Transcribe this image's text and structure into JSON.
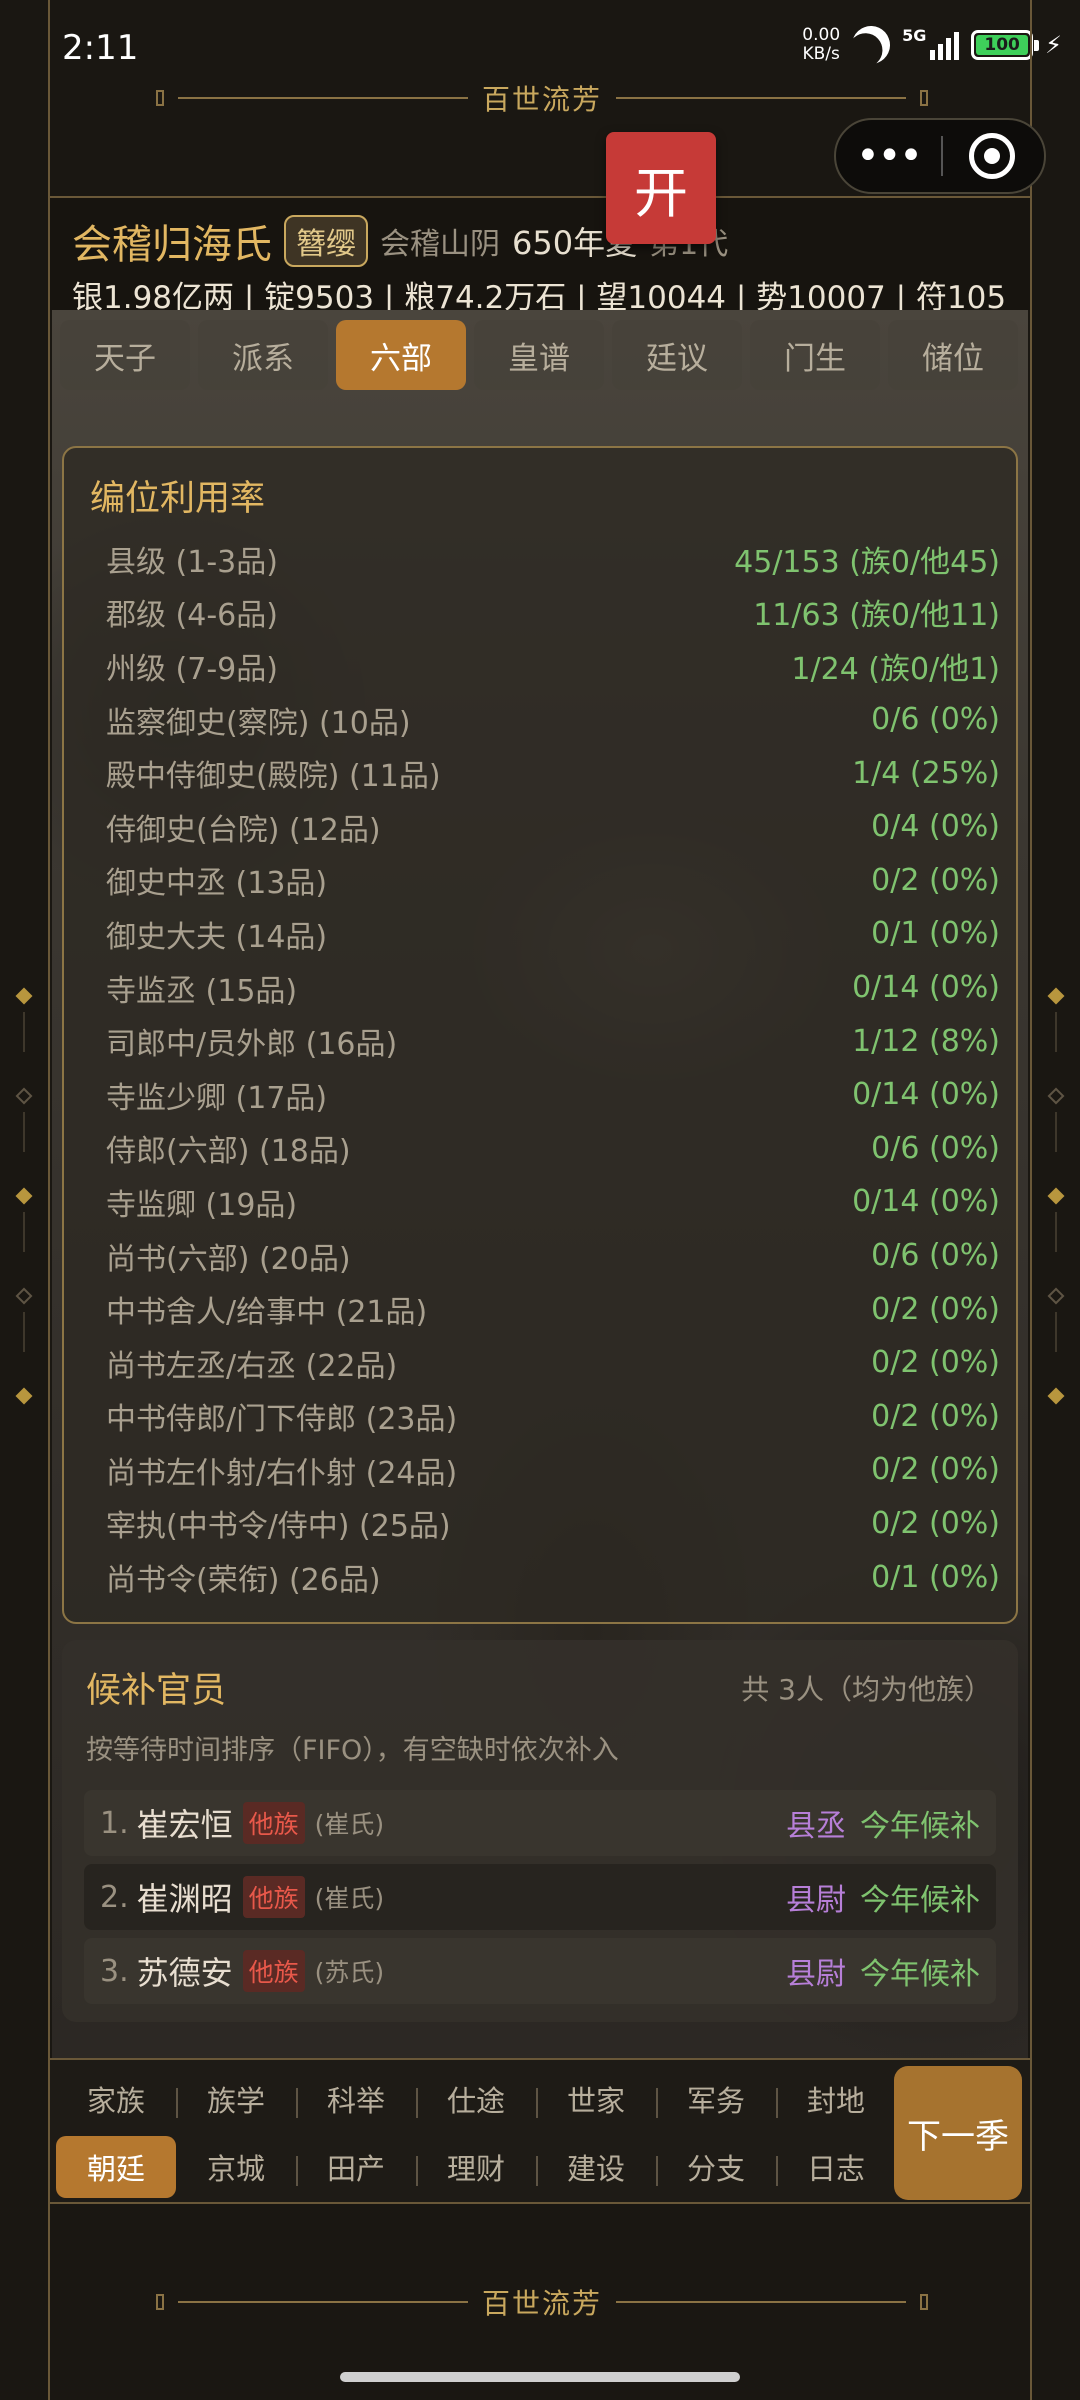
{
  "status_bar": {
    "time": "2:11",
    "net_speed_value": "0.00",
    "net_speed_unit": "KB/s",
    "network": "5G",
    "battery": "100"
  },
  "banner": {
    "title": "百世流芳"
  },
  "open_button": {
    "label": "开"
  },
  "capsule": {
    "more_icon": "more-dots-icon",
    "close_icon": "target-icon"
  },
  "header": {
    "clan_name": "会稽归海氏",
    "rank_badge": "簪缨",
    "place": "会稽山阴",
    "year": "650年夏",
    "generation": "第1代",
    "resources": "银1.98亿两 | 锭9503 | 粮74.2万石 | 望10044 | 势10007 | 符105"
  },
  "tabs": [
    {
      "label": "天子"
    },
    {
      "label": "派系"
    },
    {
      "label": "六部"
    },
    {
      "label": "皇谱"
    },
    {
      "label": "廷议"
    },
    {
      "label": "门生"
    },
    {
      "label": "储位"
    }
  ],
  "active_tab": "六部",
  "utilization": {
    "title": "编位利用率",
    "rows": [
      {
        "label": "县级 (1-3品)",
        "value": "45/153 (族0/他45)"
      },
      {
        "label": "郡级 (4-6品)",
        "value": "11/63 (族0/他11)"
      },
      {
        "label": "州级 (7-9品)",
        "value": "1/24 (族0/他1)"
      },
      {
        "label": "监察御史(察院) (10品)",
        "value": "0/6 (0%)"
      },
      {
        "label": "殿中侍御史(殿院) (11品)",
        "value": "1/4 (25%)"
      },
      {
        "label": "侍御史(台院) (12品)",
        "value": "0/4 (0%)"
      },
      {
        "label": "御史中丞 (13品)",
        "value": "0/2 (0%)"
      },
      {
        "label": "御史大夫 (14品)",
        "value": "0/1 (0%)"
      },
      {
        "label": "寺监丞 (15品)",
        "value": "0/14 (0%)"
      },
      {
        "label": "司郎中/员外郎 (16品)",
        "value": "1/12 (8%)"
      },
      {
        "label": "寺监少卿 (17品)",
        "value": "0/14 (0%)"
      },
      {
        "label": "侍郎(六部) (18品)",
        "value": "0/6 (0%)"
      },
      {
        "label": "寺监卿 (19品)",
        "value": "0/14 (0%)"
      },
      {
        "label": "尚书(六部) (20品)",
        "value": "0/6 (0%)"
      },
      {
        "label": "中书舍人/给事中 (21品)",
        "value": "0/2 (0%)"
      },
      {
        "label": "尚书左丞/右丞 (22品)",
        "value": "0/2 (0%)"
      },
      {
        "label": "中书侍郎/门下侍郎 (23品)",
        "value": "0/2 (0%)"
      },
      {
        "label": "尚书左仆射/右仆射 (24品)",
        "value": "0/2 (0%)"
      },
      {
        "label": "宰执(中书令/侍中) (25品)",
        "value": "0/2 (0%)"
      },
      {
        "label": "尚书令(荣衔) (26品)",
        "value": "0/1 (0%)"
      }
    ]
  },
  "candidates": {
    "title": "候补官员",
    "count_text": "共 3人（均为他族）",
    "description": "按等待时间排序（FIFO），有空缺时依次补入",
    "items": [
      {
        "num": "1.",
        "name": "崔宏恒",
        "tag": "他族",
        "clan": "(崔氏)",
        "post": "县丞",
        "status": "今年候补"
      },
      {
        "num": "2.",
        "name": "崔渊昭",
        "tag": "他族",
        "clan": "(崔氏)",
        "post": "县尉",
        "status": "今年候补"
      },
      {
        "num": "3.",
        "name": "苏德安",
        "tag": "他族",
        "clan": "(苏氏)",
        "post": "县尉",
        "status": "今年候补"
      }
    ]
  },
  "bottom_nav": {
    "row1": [
      "家族",
      "族学",
      "科举",
      "仕途",
      "世家",
      "军务",
      "封地"
    ],
    "row2": [
      "朝廷",
      "京城",
      "田产",
      "理财",
      "建设",
      "分支",
      "日志"
    ],
    "active": "朝廷",
    "next_button": "下一季"
  },
  "colors": {
    "accent_gold": "#e2b762",
    "active_tab": "#b5782f",
    "value_green": "#7fc36f",
    "open_red": "#c63a37",
    "post_purple": "#b77fd8"
  }
}
